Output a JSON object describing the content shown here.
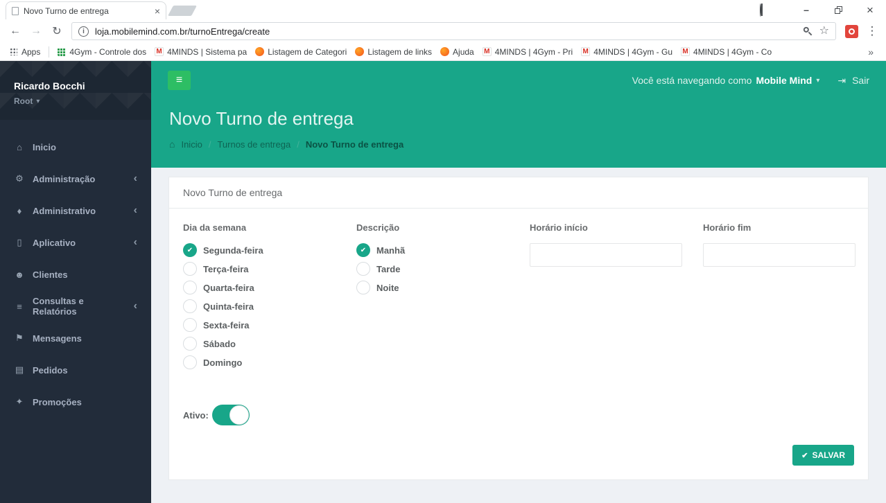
{
  "icons": {
    "back": "←",
    "forward": "→",
    "reload": "↻",
    "overflow_menu": "⋮",
    "bookmark_star": "☆",
    "bookmarks_overflow": "»",
    "tab_close": "×",
    "window_close": "×",
    "window_minimize": "–",
    "info": "i",
    "gmail_m": "M",
    "hamburger": "≡",
    "caret_down": "▾",
    "submenu_chevron": "‹",
    "home": "⌂",
    "gears": "⚙",
    "tag": "♦",
    "mobile": "▯",
    "users": "☻",
    "list": "≡",
    "megaphone": "⚑",
    "file": "▤",
    "gift": "✦",
    "check": "✔",
    "logout": "⇥"
  },
  "browser": {
    "tab_title": "Novo Turno de entrega",
    "url": "loja.mobilemind.com.br/turnoEntrega/create",
    "apps_label": "Apps",
    "bookmarks": [
      {
        "label": "4Gym - Controle dos"
      },
      {
        "label": "4MINDS | Sistema pa"
      },
      {
        "label": "Listagem de Categori"
      },
      {
        "label": "Listagem de links"
      },
      {
        "label": "Ajuda"
      },
      {
        "label": "4MINDS | 4Gym - Pri"
      },
      {
        "label": "4MINDS | 4Gym - Gu"
      },
      {
        "label": "4MINDS | 4Gym - Co"
      }
    ]
  },
  "sidebar": {
    "user_name": "Ricardo Bocchi",
    "user_role": "Root",
    "items": [
      {
        "label": "Inicio"
      },
      {
        "label": "Administração"
      },
      {
        "label": "Administrativo"
      },
      {
        "label": "Aplicativo"
      },
      {
        "label": "Clientes"
      },
      {
        "label": "Consultas e Relatórios"
      },
      {
        "label": "Mensagens"
      },
      {
        "label": "Pedidos"
      },
      {
        "label": "Promoções"
      }
    ]
  },
  "topbar": {
    "browsing_as_prefix": "Você está navegando como",
    "browsing_as_user": "Mobile Mind",
    "logout_label": "Sair"
  },
  "page": {
    "title": "Novo Turno de entrega",
    "breadcrumb": [
      {
        "label": "Inicio"
      },
      {
        "label": "Turnos de entrega"
      },
      {
        "label": "Novo Turno de entrega"
      }
    ],
    "breadcrumb_separator": "/"
  },
  "form": {
    "card_title": "Novo Turno de entrega",
    "dia_label": "Dia da semana",
    "dias": [
      {
        "label": "Segunda-feira",
        "checked": true
      },
      {
        "label": "Terça-feira",
        "checked": false
      },
      {
        "label": "Quarta-feira",
        "checked": false
      },
      {
        "label": "Quinta-feira",
        "checked": false
      },
      {
        "label": "Sexta-feira",
        "checked": false
      },
      {
        "label": "Sábado",
        "checked": false
      },
      {
        "label": "Domingo",
        "checked": false
      }
    ],
    "descricao_label": "Descrição",
    "descricoes": [
      {
        "label": "Manhã",
        "checked": true
      },
      {
        "label": "Tarde",
        "checked": false
      },
      {
        "label": "Noite",
        "checked": false
      }
    ],
    "horario_inicio_label": "Horário início",
    "horario_inicio_value": "",
    "horario_fim_label": "Horário fim",
    "horario_fim_value": "",
    "ativo_label": "Ativo:",
    "ativo_on": true,
    "save_label": "SALVAR"
  },
  "colors": {
    "teal": "#18A689",
    "green": "#2DBE64",
    "sidebar_bg": "#222C3A",
    "content_bg": "#EEF1F5"
  }
}
